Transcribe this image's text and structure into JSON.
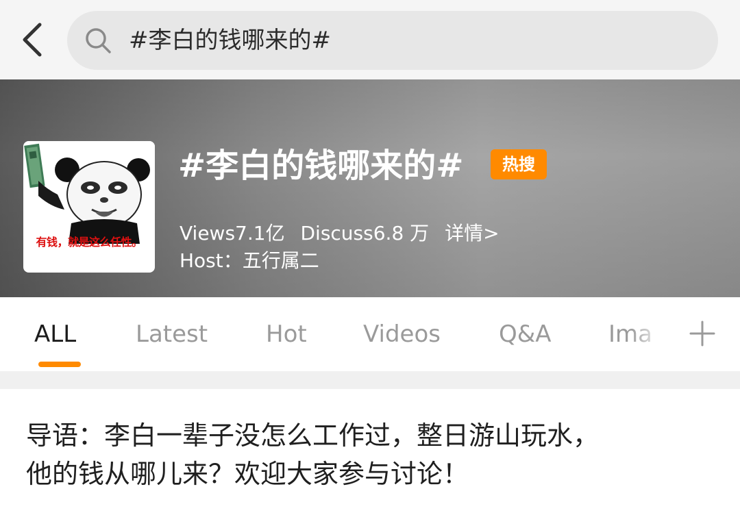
{
  "search": {
    "query": "#李白的钱哪来的#",
    "icon": "search-icon"
  },
  "back": {
    "icon": "chevron-left-icon"
  },
  "topic": {
    "thumb_caption": "有钱，就是这么任性。",
    "title": "#李白的钱哪来的#",
    "badge": "热搜",
    "views": "Views7.1亿",
    "discuss": "Discuss6.8 万",
    "detail_link": "详情>",
    "host": "Host：五行属二"
  },
  "tabs": [
    {
      "label": "ALL"
    },
    {
      "label": "Latest"
    },
    {
      "label": "Hot"
    },
    {
      "label": "Videos"
    },
    {
      "label": "Q&A"
    },
    {
      "label": "Ima"
    }
  ],
  "add_tab_icon": "plus-icon",
  "intro": {
    "line1": "导语：李白一辈子没怎么工作过，整日游山玩水，",
    "line2": "他的钱从哪儿来？欢迎大家参与讨论！"
  },
  "colors": {
    "accent": "#ff8a00",
    "hero_gray": "#8a8a8a",
    "caption_red": "#d11111"
  }
}
